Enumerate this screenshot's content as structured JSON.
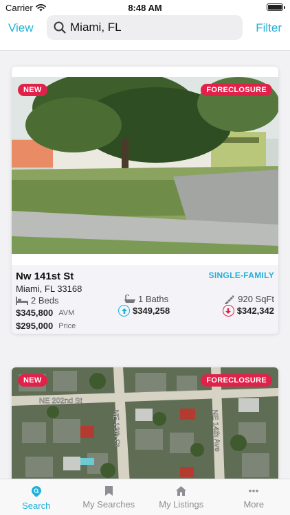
{
  "status": {
    "carrier": "Carrier",
    "time": "8:48 AM"
  },
  "navbar": {
    "view_label": "View",
    "search_value": "Miami, FL",
    "filter_label": "Filter"
  },
  "listings": [
    {
      "badge_left": "NEW",
      "badge_right": "FORECLOSURE",
      "street": "Nw 141st St",
      "property_type": "SINGLE-FAMILY",
      "city": "Miami, FL 33168",
      "beds": "2 Beds",
      "baths": "1 Baths",
      "sqft": "920 SqFt",
      "avm_value": "$345,800",
      "avm_label": "AVM",
      "up_value": "$349,258",
      "down_value": "$342,342",
      "price_value": "$295,000",
      "price_label": "Price"
    },
    {
      "badge_left": "NEW",
      "badge_right": "FORECLOSURE",
      "map_labels": [
        "NE 202nd St",
        "NE 13th Ct",
        "NE 14th Ave"
      ]
    }
  ],
  "tabs": [
    {
      "label": "Search",
      "icon": "search-icon",
      "active": true
    },
    {
      "label": "My Searches",
      "icon": "bookmark-icon",
      "active": false
    },
    {
      "label": "My Listings",
      "icon": "home-icon",
      "active": false
    },
    {
      "label": "More",
      "icon": "more-icon",
      "active": false
    }
  ],
  "colors": {
    "accent": "#1fb0d8",
    "badge": "#e0224a"
  }
}
